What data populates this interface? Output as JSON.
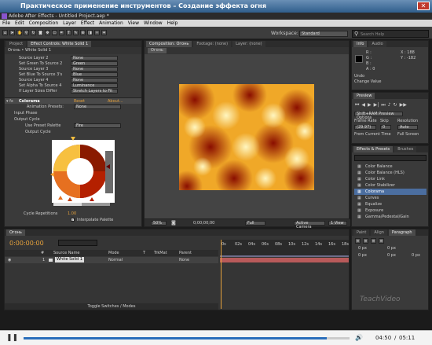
{
  "window": {
    "title": "Практическое применение инструментов – Создание эффекта огня",
    "app_title": "Adobe After Effects - Untitled Project.aep *"
  },
  "menu": [
    "File",
    "Edit",
    "Composition",
    "Layer",
    "Effect",
    "Animation",
    "View",
    "Window",
    "Help"
  ],
  "toolbar": {
    "workspace_label": "Workspace:",
    "workspace_value": "Standard",
    "search_placeholder": "Search Help"
  },
  "left_panel": {
    "tabs": [
      "Project",
      "Effect Controls: White Solid 1"
    ],
    "breadcrumb": "Огонь • White Solid 1",
    "rows": [
      "Source Layer 2",
      "Set Green To Source 2",
      "Source Layer 3",
      "Set Blue To Source 3's",
      "Source Layer 4",
      "Set Alpha To Source 4",
      "If Layer Sizes Differ"
    ],
    "row_values": [
      "None",
      "Green",
      "None",
      "Blue",
      "None",
      "Luminance",
      "Stretch Layers to Fit"
    ],
    "effect_name": "Colorama",
    "reset": "Reset",
    "about": "About...",
    "animation_presets_label": "Animation Presets:",
    "animation_presets_value": "None",
    "input_phase": "Input Phase",
    "output_cycle": "Output Cycle",
    "use_preset_palette": "Use Preset Palette",
    "palette_value": "Fire",
    "output_cycle_sub": "Output Cycle",
    "cycle_repetitions_label": "Cycle Repetitions",
    "cycle_repetitions_value": "1.00",
    "interpolate_palette": "Interpolate Palette"
  },
  "comp_panel": {
    "tabs": [
      "Composition: Огонь",
      "Footage: (none)",
      "Layer: (none)"
    ],
    "breadcrumb": "Огонь",
    "zoom": "50%",
    "timecode": "0;00;00;00",
    "resolution": "Full",
    "camera": "Active Camera",
    "view": "1 View"
  },
  "info_panel": {
    "tabs": [
      "Info",
      "Audio"
    ],
    "x": "X : 188",
    "y": "Y : -182",
    "r": "R :",
    "g": "G :",
    "b": "B :",
    "a": "A : 0",
    "undo": "Undo",
    "change": "Change Value"
  },
  "preview_panel": {
    "tab": "Preview",
    "options": "Shift+RAM Preview Options",
    "frame_rate_label": "Frame Rate",
    "skip_label": "Skip",
    "resolution_label": "Resolution",
    "frame_rate": "(29.97)",
    "skip": "0",
    "resolution": "Auto",
    "from_current": "From Current Time",
    "full_screen": "Full Screen"
  },
  "effects_panel": {
    "tabs": [
      "Effects & Presets",
      "Brushes"
    ],
    "items": [
      "Color Balance",
      "Color Balance (HLS)",
      "Color Link",
      "Color Stabilizer",
      "Colorama",
      "Curves",
      "Equalize",
      "Exposure",
      "Gamma/Pedestal/Gain"
    ],
    "selected": 4
  },
  "paragraph_panel": {
    "tabs": [
      "Paint",
      "Align",
      "Paragraph"
    ],
    "values": [
      "0 px",
      "0 px",
      "0 px",
      "0 px",
      "0 px"
    ]
  },
  "timeline": {
    "tab": "Огонь",
    "timecode": "0:00:00:00",
    "col_headers": [
      "#",
      "Source Name",
      "Mode",
      "T",
      "TrkMat",
      "Parent"
    ],
    "layer": {
      "index": "1",
      "name": "White Solid 1",
      "mode": "Normal",
      "parent": "None"
    },
    "ruler": [
      "0s",
      "02s",
      "04s",
      "06s",
      "08s",
      "10s",
      "12s",
      "14s",
      "16s",
      "18s"
    ],
    "toggle": "Toggle Switches / Modes"
  },
  "player": {
    "current": "04:50",
    "total": "05:11"
  },
  "watermark": "TeachVideo",
  "colors": {
    "accent": "#e6a23c",
    "selection": "#4b6ea0",
    "fire": "#e8a020"
  }
}
